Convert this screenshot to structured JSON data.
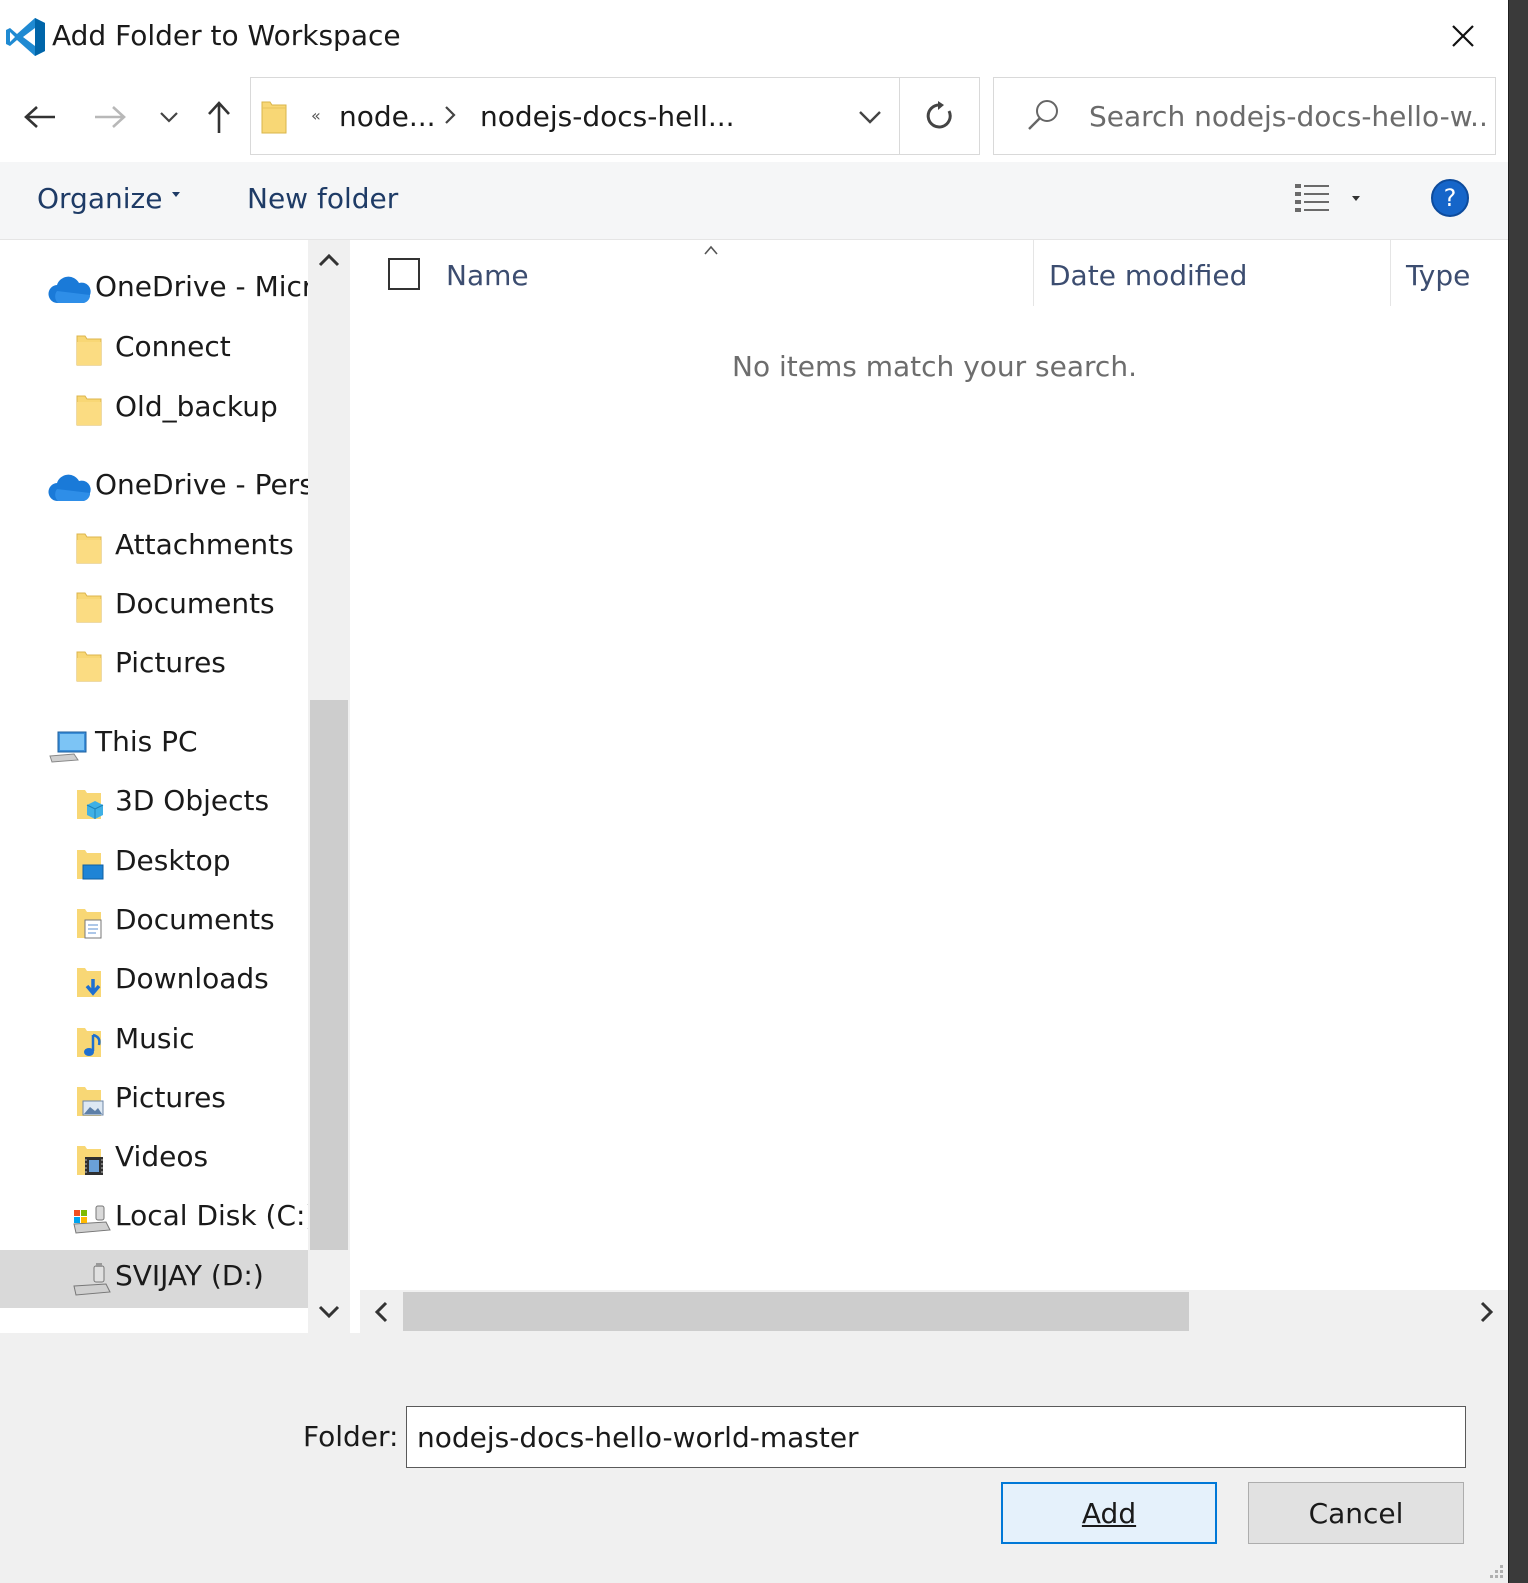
{
  "window": {
    "title": "Add Folder to Workspace",
    "app_icon": "vscode-icon"
  },
  "address_bar": {
    "overflow_marker": "«",
    "crumbs": [
      "node...",
      "nodejs-docs-hell..."
    ]
  },
  "search": {
    "placeholder": "Search nodejs-docs-hello-w..."
  },
  "toolbar": {
    "organize_label": "Organize",
    "new_folder_label": "New folder",
    "help_label": "?"
  },
  "nav_pane": {
    "items": [
      {
        "label": "OneDrive - Micro",
        "icon": "onedrive-icon",
        "level": 0
      },
      {
        "label": "Connect",
        "icon": "folder-icon",
        "level": 1
      },
      {
        "label": "Old_backup",
        "icon": "folder-icon",
        "level": 1
      },
      {
        "label": "OneDrive - Perso",
        "icon": "onedrive-icon",
        "level": 0
      },
      {
        "label": "Attachments",
        "icon": "folder-icon",
        "level": 1
      },
      {
        "label": "Documents",
        "icon": "folder-icon",
        "level": 1
      },
      {
        "label": "Pictures",
        "icon": "folder-icon",
        "level": 1
      },
      {
        "label": "This PC",
        "icon": "this-pc-icon",
        "level": 0
      },
      {
        "label": "3D Objects",
        "icon": "3d-objects-icon",
        "level": 1
      },
      {
        "label": "Desktop",
        "icon": "desktop-folder-icon",
        "level": 1
      },
      {
        "label": "Documents",
        "icon": "documents-folder-icon",
        "level": 1
      },
      {
        "label": "Downloads",
        "icon": "downloads-folder-icon",
        "level": 1
      },
      {
        "label": "Music",
        "icon": "music-folder-icon",
        "level": 1
      },
      {
        "label": "Pictures",
        "icon": "pictures-folder-icon",
        "level": 1
      },
      {
        "label": "Videos",
        "icon": "videos-folder-icon",
        "level": 1
      },
      {
        "label": "Local Disk (C:)",
        "icon": "local-disk-icon",
        "level": 1
      },
      {
        "label": "SVIJAY (D:)",
        "icon": "usb-drive-icon",
        "level": 1,
        "selected": true
      }
    ]
  },
  "file_list": {
    "columns": [
      "Name",
      "Date modified",
      "Type"
    ],
    "empty_message": "No items match your search."
  },
  "footer": {
    "folder_label": "Folder:",
    "folder_value": "nodejs-docs-hello-world-master",
    "add_label": "Add",
    "cancel_label": "Cancel"
  },
  "colors": {
    "accent": "#0078d7",
    "link_text": "#1e3b66",
    "folder_yellow": "#f8d775",
    "help_blue": "#1565c9"
  }
}
